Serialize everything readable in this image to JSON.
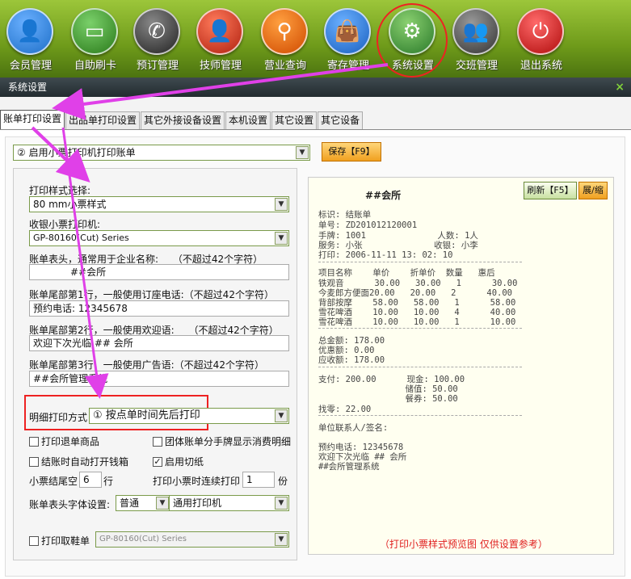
{
  "toolbar": {
    "items": [
      {
        "label": "会员管理",
        "icon": "member-icon",
        "color": "#1e6fc8"
      },
      {
        "label": "自助刷卡",
        "icon": "card-icon",
        "color": "#3a8a2a"
      },
      {
        "label": "预订管理",
        "icon": "phone-icon",
        "color": "#3a3a3a"
      },
      {
        "label": "技师管理",
        "icon": "technician-icon",
        "color": "#c83018"
      },
      {
        "label": "营业查询",
        "icon": "search-icon",
        "color": "#e05a10"
      },
      {
        "label": "寄存管理",
        "icon": "bag-icon",
        "color": "#2a7ad0"
      },
      {
        "label": "系统设置",
        "icon": "gear-icon",
        "color": "#3a8a3a"
      },
      {
        "label": "交班管理",
        "icon": "handover-icon",
        "color": "#404040"
      },
      {
        "label": "退出系统",
        "icon": "power-icon",
        "color": "#c81818"
      }
    ]
  },
  "window": {
    "title": "系统设置",
    "close": "×"
  },
  "tabs": [
    "账单打印设置",
    "出品单打印设置",
    "其它外接设备设置",
    "本机设置",
    "其它设置",
    "其它设备"
  ],
  "main": {
    "enable_select": "② 启用小票打印机打印账单",
    "save_label": "保存【F9】",
    "print_style_label": "打印样式选择:",
    "print_style_value": "80  mm小票样式",
    "cashier_printer_label": "收银小票打印机:",
    "cashier_printer_value": "GP-80160(Cut) Series",
    "header_label": "账单表头，通常用于企业名称:",
    "header_limit": "（不超过42个字符）",
    "header_value": "##会所",
    "footer1_label": "账单尾部第1行，一般使用订座电话:（不超过42个字符）",
    "footer1_value": "预约电话: 12345678",
    "footer2_label": "账单尾部第2行，一般使用欢迎语:",
    "footer2_limit": "（不超过42个字符）",
    "footer2_value": "欢迎下次光临 ## 会所",
    "footer3_label": "账单尾部第3行，一般使用广告语:（不超过42个字符）",
    "footer3_value": "##会所管理系统",
    "detail_mode_label": "明细打印方式",
    "detail_mode_value": "① 按点单时间先后打印",
    "chk_print_return": "打印退单商品",
    "chk_group_bill": "团体账单分手牌显示消费明细",
    "chk_open_drawer": "结账时自动打开钱箱",
    "chk_cut": "启用切纸",
    "tail_blank_label": "小票结尾空",
    "tail_blank_value": "6",
    "tail_blank_unit": "行",
    "continuous_label": "打印小票时连续打印",
    "continuous_value": "1",
    "continuous_unit": "份",
    "font_label": "账单表头字体设置:",
    "font_style": "普通",
    "font_printer": "通用打印机",
    "shoe_label": "打印取鞋单",
    "shoe_printer": "GP-80160(Cut) Series"
  },
  "preview": {
    "refresh_label": "刷新【F5】",
    "expand_label": "展/缩",
    "title": "##会所",
    "lines": [
      "标识: 结账单",
      "单号: ZD201012120001",
      "手牌: 1001              人数: 1人",
      "服务: 小张              收银: 小李",
      "打印: 2006-11-11 13: 02: 10"
    ],
    "table_header": "项目名称    单价    折单价  数量   惠后",
    "items": [
      "铁观音      30.00   30.00   1      30.00",
      "今麦郎方便面20.00   20.00   2      40.00",
      "背部按摩    58.00   58.00   1      58.00",
      "雪花啤酒    10.00   10.00   4      40.00",
      "雪花啤酒    10.00   10.00   1      10.00"
    ],
    "totals": [
      "总金额: 178.00",
      "优惠额: 0.00",
      "应收额: 178.00"
    ],
    "payment": [
      "支付: 200.00      现金: 100.00",
      "                 储值: 50.00",
      "                 餐券: 50.00"
    ],
    "change": "找零: 22.00",
    "contact": "单位联系人/签名:",
    "footer": [
      "预约电话: 12345678",
      "欢迎下次光临 ## 会所",
      "##会所管理系统"
    ],
    "note": "（打印小票样式预览图 仅供设置参考）"
  }
}
